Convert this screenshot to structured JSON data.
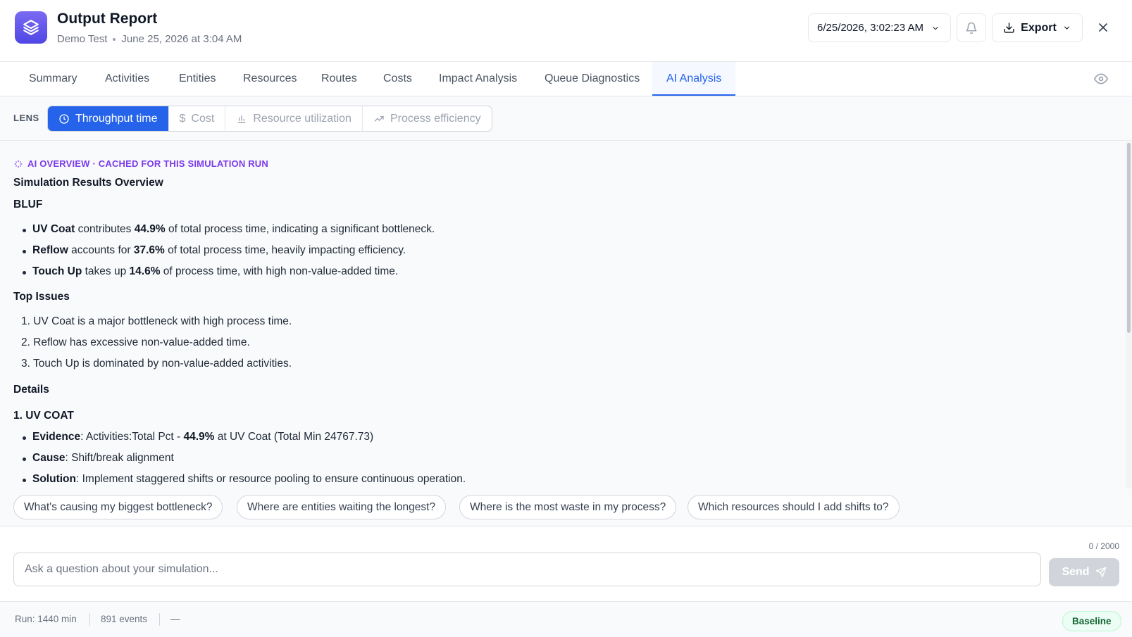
{
  "header": {
    "title": "Output Report",
    "subtitle_project": "Demo Test",
    "subtitle_date": "June 25, 2026 at 3:04 AM",
    "run_select_value": "6/25/2026, 3:02:23 AM",
    "export_label": "Export",
    "logo_icon": "layers-icon",
    "accent_color": "#2563eb",
    "logo_color": "#6056ec"
  },
  "tabs": [
    {
      "label": "Summary"
    },
    {
      "label": "Activities"
    },
    {
      "label": "Entities"
    },
    {
      "label": "Resources"
    },
    {
      "label": "Routes"
    },
    {
      "label": "Costs"
    },
    {
      "label": "Impact Analysis"
    },
    {
      "label": "Queue Diagnostics"
    },
    {
      "label": "AI Analysis",
      "active": true
    }
  ],
  "lens": {
    "label": "LENS",
    "options": [
      {
        "label": "Throughput time",
        "icon": "clock-icon",
        "active": true
      },
      {
        "label": "Cost",
        "icon": "dollar-icon"
      },
      {
        "label": "Resource utilization",
        "icon": "bar-chart-icon"
      },
      {
        "label": "Process efficiency",
        "icon": "trending-up-icon"
      }
    ]
  },
  "content": {
    "ai_tag": "AI OVERVIEW · CACHED FOR THIS SIMULATION RUN",
    "heading": "Simulation Results Overview",
    "bluf_heading": "BLUF",
    "bluf": [
      {
        "name": "UV Coat",
        "mid": " contributes ",
        "pct": "44.9%",
        "rest": " of total process time, indicating a significant bottleneck."
      },
      {
        "name": "Reflow",
        "mid": " accounts for ",
        "pct": "37.6%",
        "rest": " of total process time, heavily impacting efficiency."
      },
      {
        "name": "Touch Up",
        "mid": " takes up ",
        "pct": "14.6%",
        "rest": " of process time, with high non-value-added time."
      }
    ],
    "top_issues_heading": "Top Issues",
    "top_issues": [
      "1. UV Coat is a major bottleneck with high process time.",
      "2. Reflow has excessive non-value-added time.",
      "3. Touch Up is dominated by non-value-added activities."
    ],
    "details_heading": "Details",
    "detail_1_heading": "1. UV COAT",
    "detail_1": {
      "evidence_label": "Evidence",
      "evidence_pre": ": Activities:Total Pct - ",
      "evidence_pct": "44.9%",
      "evidence_post": " at UV Coat (Total Min 24767.73)",
      "cause_label": "Cause",
      "cause_text": ": Shift/break alignment",
      "solution_label": "Solution",
      "solution_text": ": Implement staggered shifts or resource pooling to ensure continuous operation."
    }
  },
  "suggestions": [
    "What's causing my biggest bottleneck?",
    "Where are entities waiting the longest?",
    "Where is the most waste in my process?",
    "Which resources should I add shifts to?"
  ],
  "input": {
    "placeholder": "Ask a question about your simulation...",
    "value": "",
    "char_count": "0 / 2000",
    "send_label": "Send"
  },
  "status": {
    "run": "Run: 1440 min",
    "events": "891 events",
    "extra": "—",
    "badge": "Baseline"
  }
}
